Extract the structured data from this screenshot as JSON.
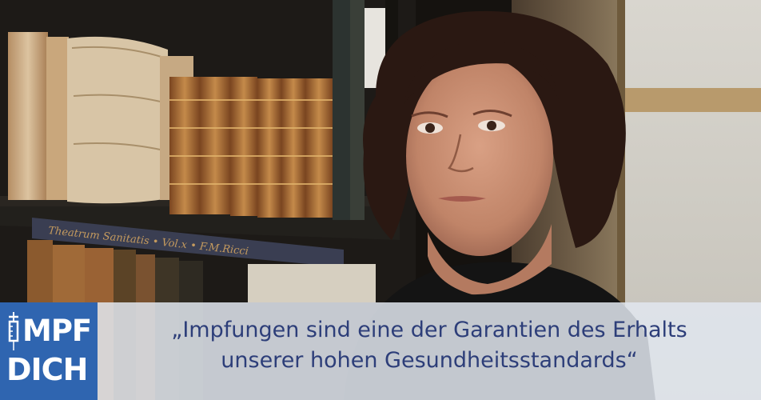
{
  "logo": {
    "line1": "MPF",
    "line2": "DICH",
    "icon": "syringe-icon",
    "bg_color": "#2f65b0"
  },
  "quote": {
    "line1": "„Impfungen sind eine der Garantien des Erhalts",
    "line2": "unserer hohen Gesundheitsstandards“",
    "color": "#2d3e79"
  },
  "photo": {
    "book_spine_text": "Theatrum Sanitatis • Vol.x • F.M.Ricci"
  }
}
